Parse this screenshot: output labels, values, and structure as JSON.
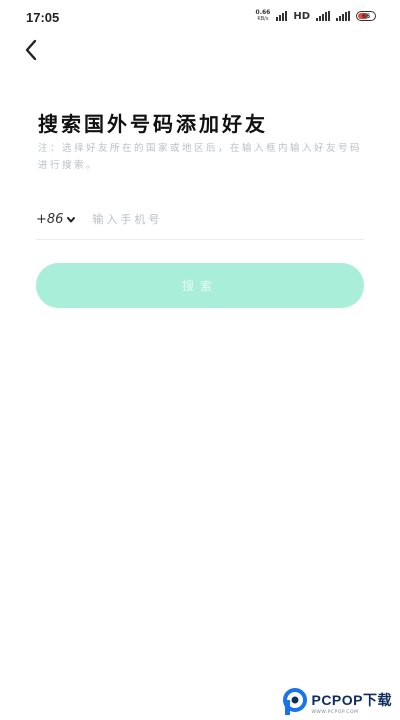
{
  "status_bar": {
    "time": "17:05",
    "net_speed": "0.66",
    "net_speed_unit": "KB/s",
    "hd": "HD",
    "battery": "66"
  },
  "page": {
    "title": "搜索国外号码添加好友",
    "hint": "注：选择好友所在的国家或地区后，在输入框内输入好友号码进行搜索。"
  },
  "phone": {
    "country_code": "+86",
    "placeholder": "输入手机号",
    "value": ""
  },
  "search": {
    "label": "搜索"
  },
  "colors": {
    "accent_disabled": "#a9eed9",
    "hint_gray": "#b9c0c6"
  },
  "watermark": {
    "title": "PCPOP下载",
    "subtitle": "WWW.PCPOP.COM"
  }
}
